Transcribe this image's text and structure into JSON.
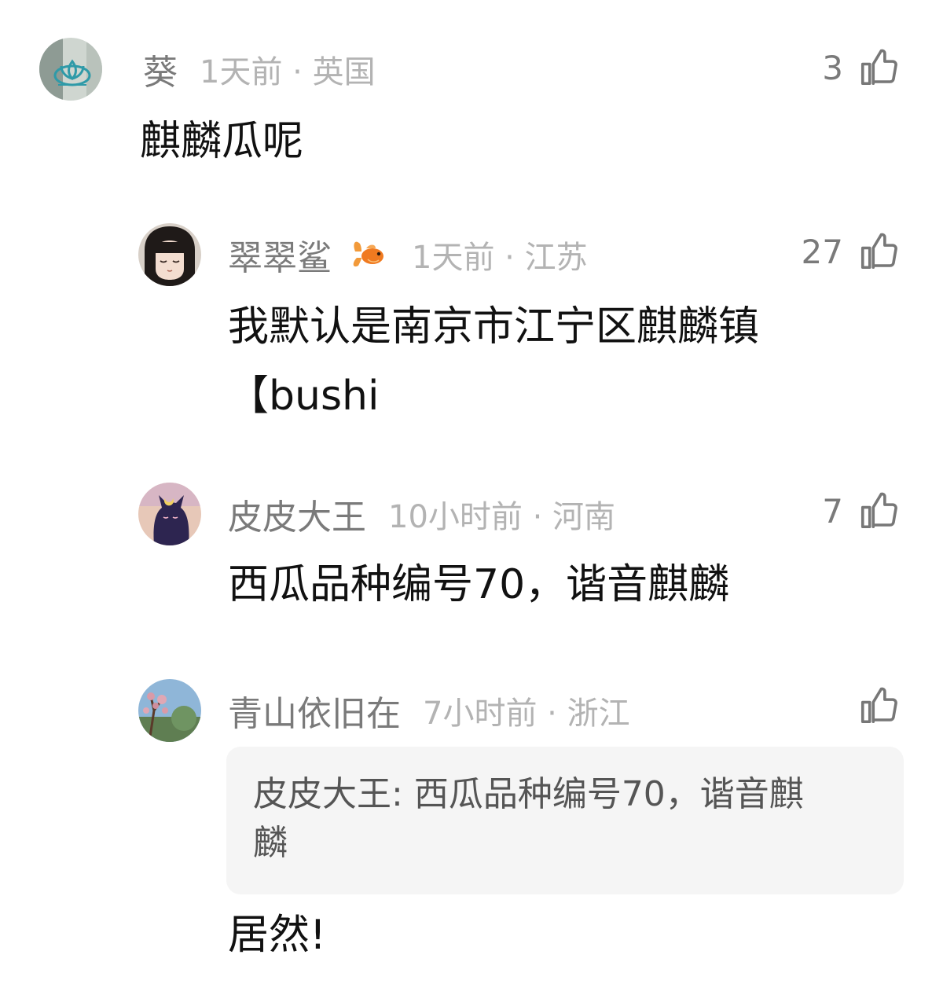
{
  "comments": [
    {
      "name": "葵",
      "time": "1天前 · 英国",
      "likes": "3",
      "text": "麒麟瓜呢",
      "avatar": "lotus-avatar-icon"
    },
    {
      "name": "翠翠鲨",
      "badge": "goldfish-badge-icon",
      "time": "1天前 · 江苏",
      "likes": "27",
      "text_line1": "我默认是南京市江宁区麒麟镇",
      "text_line2": "【bushi",
      "avatar": "anime-girl-avatar-icon"
    },
    {
      "name": "皮皮大王",
      "time": "10小时前 · 河南",
      "likes": "7",
      "text": "西瓜品种编号70，谐音麒麟",
      "avatar": "black-cat-avatar-icon"
    },
    {
      "name": "青山依旧在",
      "time": "7小时前 · 浙江",
      "likes": "",
      "quote_author": "皮皮大王:",
      "quote_text": " 西瓜品种编号70，谐音麒",
      "quote_text2": "麟",
      "text": "居然!",
      "avatar": "blossom-tree-avatar-icon"
    }
  ],
  "colors": {
    "name": "#7a7a7a",
    "time": "#b3b3b3",
    "body": "#111111",
    "quote_bg": "#f5f5f5"
  }
}
